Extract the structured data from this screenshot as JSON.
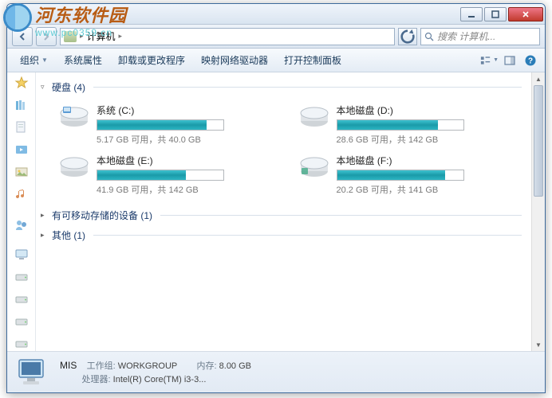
{
  "watermark": {
    "title": "河东软件园",
    "url": "www.pc0359.cn"
  },
  "titlebar": {
    "minimize": "—",
    "maximize": "☐",
    "close": "✕"
  },
  "nav": {
    "crumb1": "计算机",
    "crumb_sep": "▸",
    "search_placeholder": "搜索 计算机..."
  },
  "toolbar": {
    "organize": "组织",
    "properties": "系统属性",
    "uninstall": "卸载或更改程序",
    "map_drive": "映射网络驱动器",
    "control_panel": "打开控制面板"
  },
  "groups": {
    "hdd": {
      "arrow": "▿",
      "label": "硬盘 (4)"
    },
    "removable": {
      "arrow": "▸",
      "label": "有可移动存储的设备 (1)"
    },
    "other": {
      "arrow": "▸",
      "label": "其他 (1)"
    }
  },
  "drives": [
    {
      "name": "系统 (C:)",
      "fill_pct": 87,
      "status": "5.17 GB 可用，共 40.0 GB"
    },
    {
      "name": "本地磁盘 (D:)",
      "fill_pct": 80,
      "status": "28.6 GB 可用，共 142 GB"
    },
    {
      "name": "本地磁盘 (E:)",
      "fill_pct": 70,
      "status": "41.9 GB 可用，共 142 GB"
    },
    {
      "name": "本地磁盘 (F:)",
      "fill_pct": 86,
      "status": "20.2 GB 可用，共 141 GB"
    }
  ],
  "details": {
    "name": "MIS",
    "workgroup_label": "工作组:",
    "workgroup": "WORKGROUP",
    "memory_label": "内存:",
    "memory": "8.00 GB",
    "cpu_label": "处理器:",
    "cpu": "Intel(R) Core(TM) i3-3..."
  }
}
